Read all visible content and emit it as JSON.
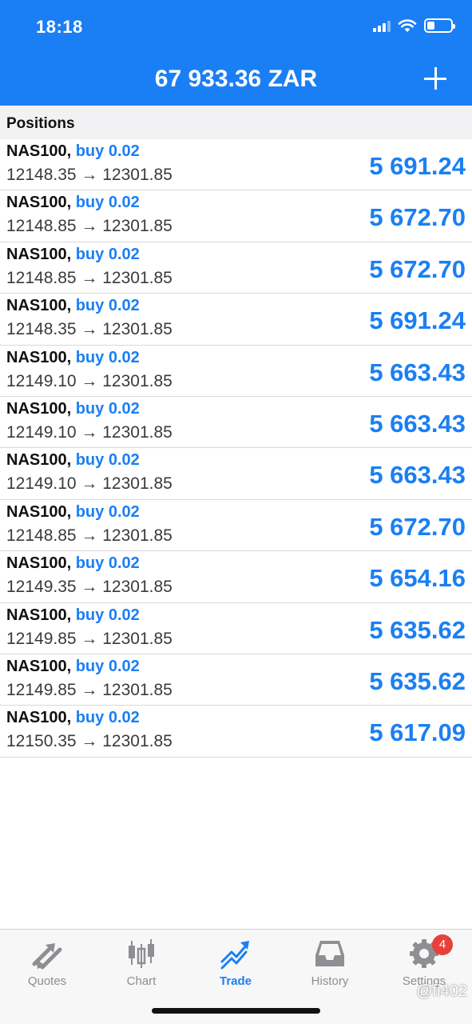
{
  "status_bar": {
    "time": "18:18"
  },
  "header": {
    "balance": "67 933.36 ZAR"
  },
  "section": {
    "title": "Positions"
  },
  "positions": [
    {
      "symbol": "NAS100,",
      "side": "buy 0.02",
      "prices": "12148.35 → 12301.85",
      "profit": "5 691.24"
    },
    {
      "symbol": "NAS100,",
      "side": "buy 0.02",
      "prices": "12148.85 → 12301.85",
      "profit": "5 672.70"
    },
    {
      "symbol": "NAS100,",
      "side": "buy 0.02",
      "prices": "12148.85 → 12301.85",
      "profit": "5 672.70"
    },
    {
      "symbol": "NAS100,",
      "side": "buy 0.02",
      "prices": "12148.35 → 12301.85",
      "profit": "5 691.24"
    },
    {
      "symbol": "NAS100,",
      "side": "buy 0.02",
      "prices": "12149.10 → 12301.85",
      "profit": "5 663.43"
    },
    {
      "symbol": "NAS100,",
      "side": "buy 0.02",
      "prices": "12149.10 → 12301.85",
      "profit": "5 663.43"
    },
    {
      "symbol": "NAS100,",
      "side": "buy 0.02",
      "prices": "12149.10 → 12301.85",
      "profit": "5 663.43"
    },
    {
      "symbol": "NAS100,",
      "side": "buy 0.02",
      "prices": "12148.85 → 12301.85",
      "profit": "5 672.70"
    },
    {
      "symbol": "NAS100,",
      "side": "buy 0.02",
      "prices": "12149.35 → 12301.85",
      "profit": "5 654.16"
    },
    {
      "symbol": "NAS100,",
      "side": "buy 0.02",
      "prices": "12149.85 → 12301.85",
      "profit": "5 635.62"
    },
    {
      "symbol": "NAS100,",
      "side": "buy 0.02",
      "prices": "12149.85 → 12301.85",
      "profit": "5 635.62"
    },
    {
      "symbol": "NAS100,",
      "side": "buy 0.02",
      "prices": "12150.35 → 12301.85",
      "profit": "5 617.09"
    }
  ],
  "tabs": [
    {
      "label": "Quotes",
      "icon": "quotes-arrows-icon",
      "active": false
    },
    {
      "label": "Chart",
      "icon": "candlestick-icon",
      "active": false
    },
    {
      "label": "Trade",
      "icon": "trend-icon",
      "active": true
    },
    {
      "label": "History",
      "icon": "inbox-icon",
      "active": false
    },
    {
      "label": "Settings",
      "icon": "gear-icon",
      "active": false,
      "badge": "4"
    }
  ],
  "watermark": "@fi402",
  "colors": {
    "accent": "#1a7ff5",
    "badge": "#e8403a",
    "tab_inactive": "#8e8e93"
  }
}
